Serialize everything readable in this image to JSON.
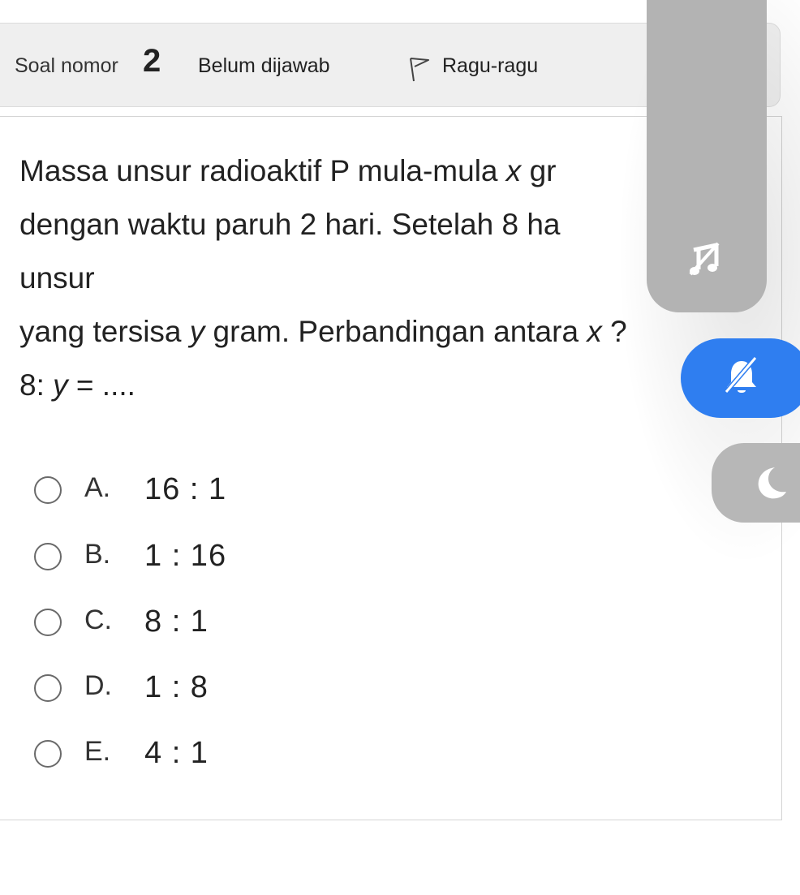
{
  "header": {
    "soal_label": "Soal nomor",
    "soal_number": "2",
    "status": "Belum dijawab",
    "ragu_label": "Ragu-ragu"
  },
  "question": {
    "line1_a": "Massa unsur radioaktif P mula-mula ",
    "line1_var": "x",
    "line1_b": " gr",
    "line2": "dengan waktu paruh 2 hari. Setelah 8 ha",
    "line3": "unsur",
    "line4_a": "yang tersisa ",
    "line4_var": "y",
    "line4_b": " gram. Perbandingan antara ",
    "line4_var2": "x",
    "line4_c": " ?",
    "line5_a": "8: ",
    "line5_var": "y",
    "line5_b": " = ...."
  },
  "options": [
    {
      "letter": "A.",
      "value": "16 : 1"
    },
    {
      "letter": "B.",
      "value": "1 : 16"
    },
    {
      "letter": "C.",
      "value": "8 : 1"
    },
    {
      "letter": "D.",
      "value": "1 : 8"
    },
    {
      "letter": "E.",
      "value": "4 : 1"
    }
  ],
  "overlay": {
    "panel_icon": "music-off-icon",
    "blue_button_icon": "bell-off-icon",
    "moon_button_icon": "moon-icon",
    "colors": {
      "panel": "#b3b3b3",
      "blue": "#2f7ef0",
      "moon": "#b7b7b7"
    }
  }
}
